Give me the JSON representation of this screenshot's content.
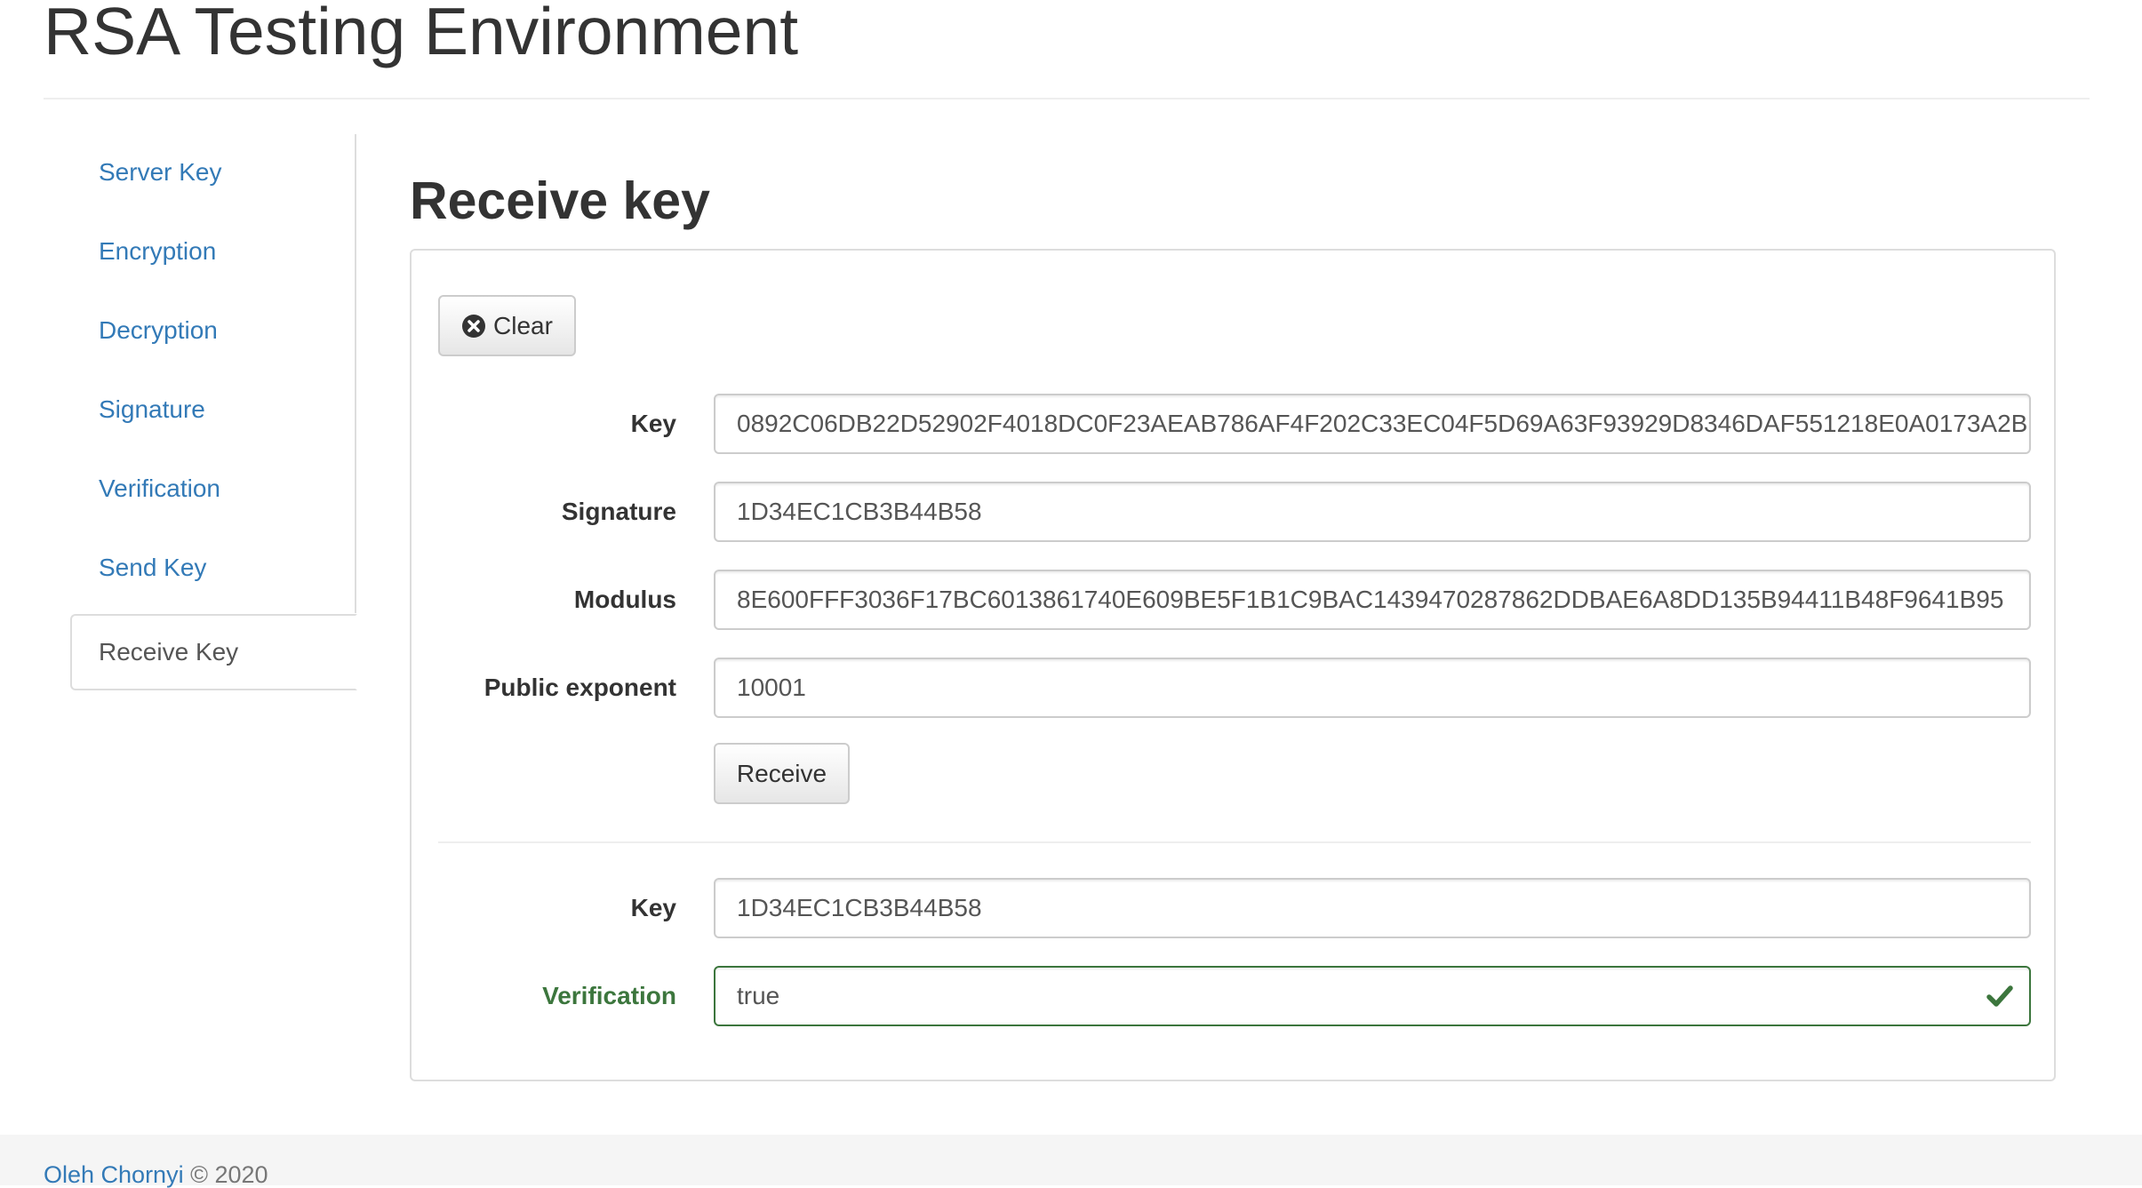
{
  "header": {
    "title": "RSA Testing Environment"
  },
  "sidebar": {
    "items": [
      {
        "label": "Server Key",
        "active": false
      },
      {
        "label": "Encryption",
        "active": false
      },
      {
        "label": "Decryption",
        "active": false
      },
      {
        "label": "Signature",
        "active": false
      },
      {
        "label": "Verification",
        "active": false
      },
      {
        "label": "Send Key",
        "active": false
      },
      {
        "label": "Receive Key",
        "active": true
      }
    ]
  },
  "main": {
    "title": "Receive key",
    "clear_button": {
      "label": "Clear",
      "icon": "times-circle-icon"
    },
    "form": {
      "key": {
        "label": "Key",
        "value": "0892C06DB22D52902F4018DC0F23AEAB786AF4F202C33EC04F5D69A63F93929D8346DAF551218E0A0173A2B"
      },
      "signature": {
        "label": "Signature",
        "value": "1D34EC1CB3B44B58"
      },
      "modulus": {
        "label": "Modulus",
        "value": "8E600FFF3036F17BC6013861740E609BE5F1B1C9BAC1439470287862DDBAE6A8DD135B94411B48F9641B95"
      },
      "public_exponent": {
        "label": "Public exponent",
        "value": "10001"
      }
    },
    "receive_button": {
      "label": "Receive"
    },
    "result": {
      "key": {
        "label": "Key",
        "value": "1D34EC1CB3B44B58"
      },
      "verification": {
        "label": "Verification",
        "value": "true",
        "icon": "checkmark-icon"
      }
    }
  },
  "footer": {
    "author": "Oleh Chornyi",
    "copyright": "© 2020"
  },
  "colors": {
    "link": "#337ab7",
    "success": "#3c763d",
    "border": "#cccccc",
    "footer_bg": "#f5f5f5"
  }
}
